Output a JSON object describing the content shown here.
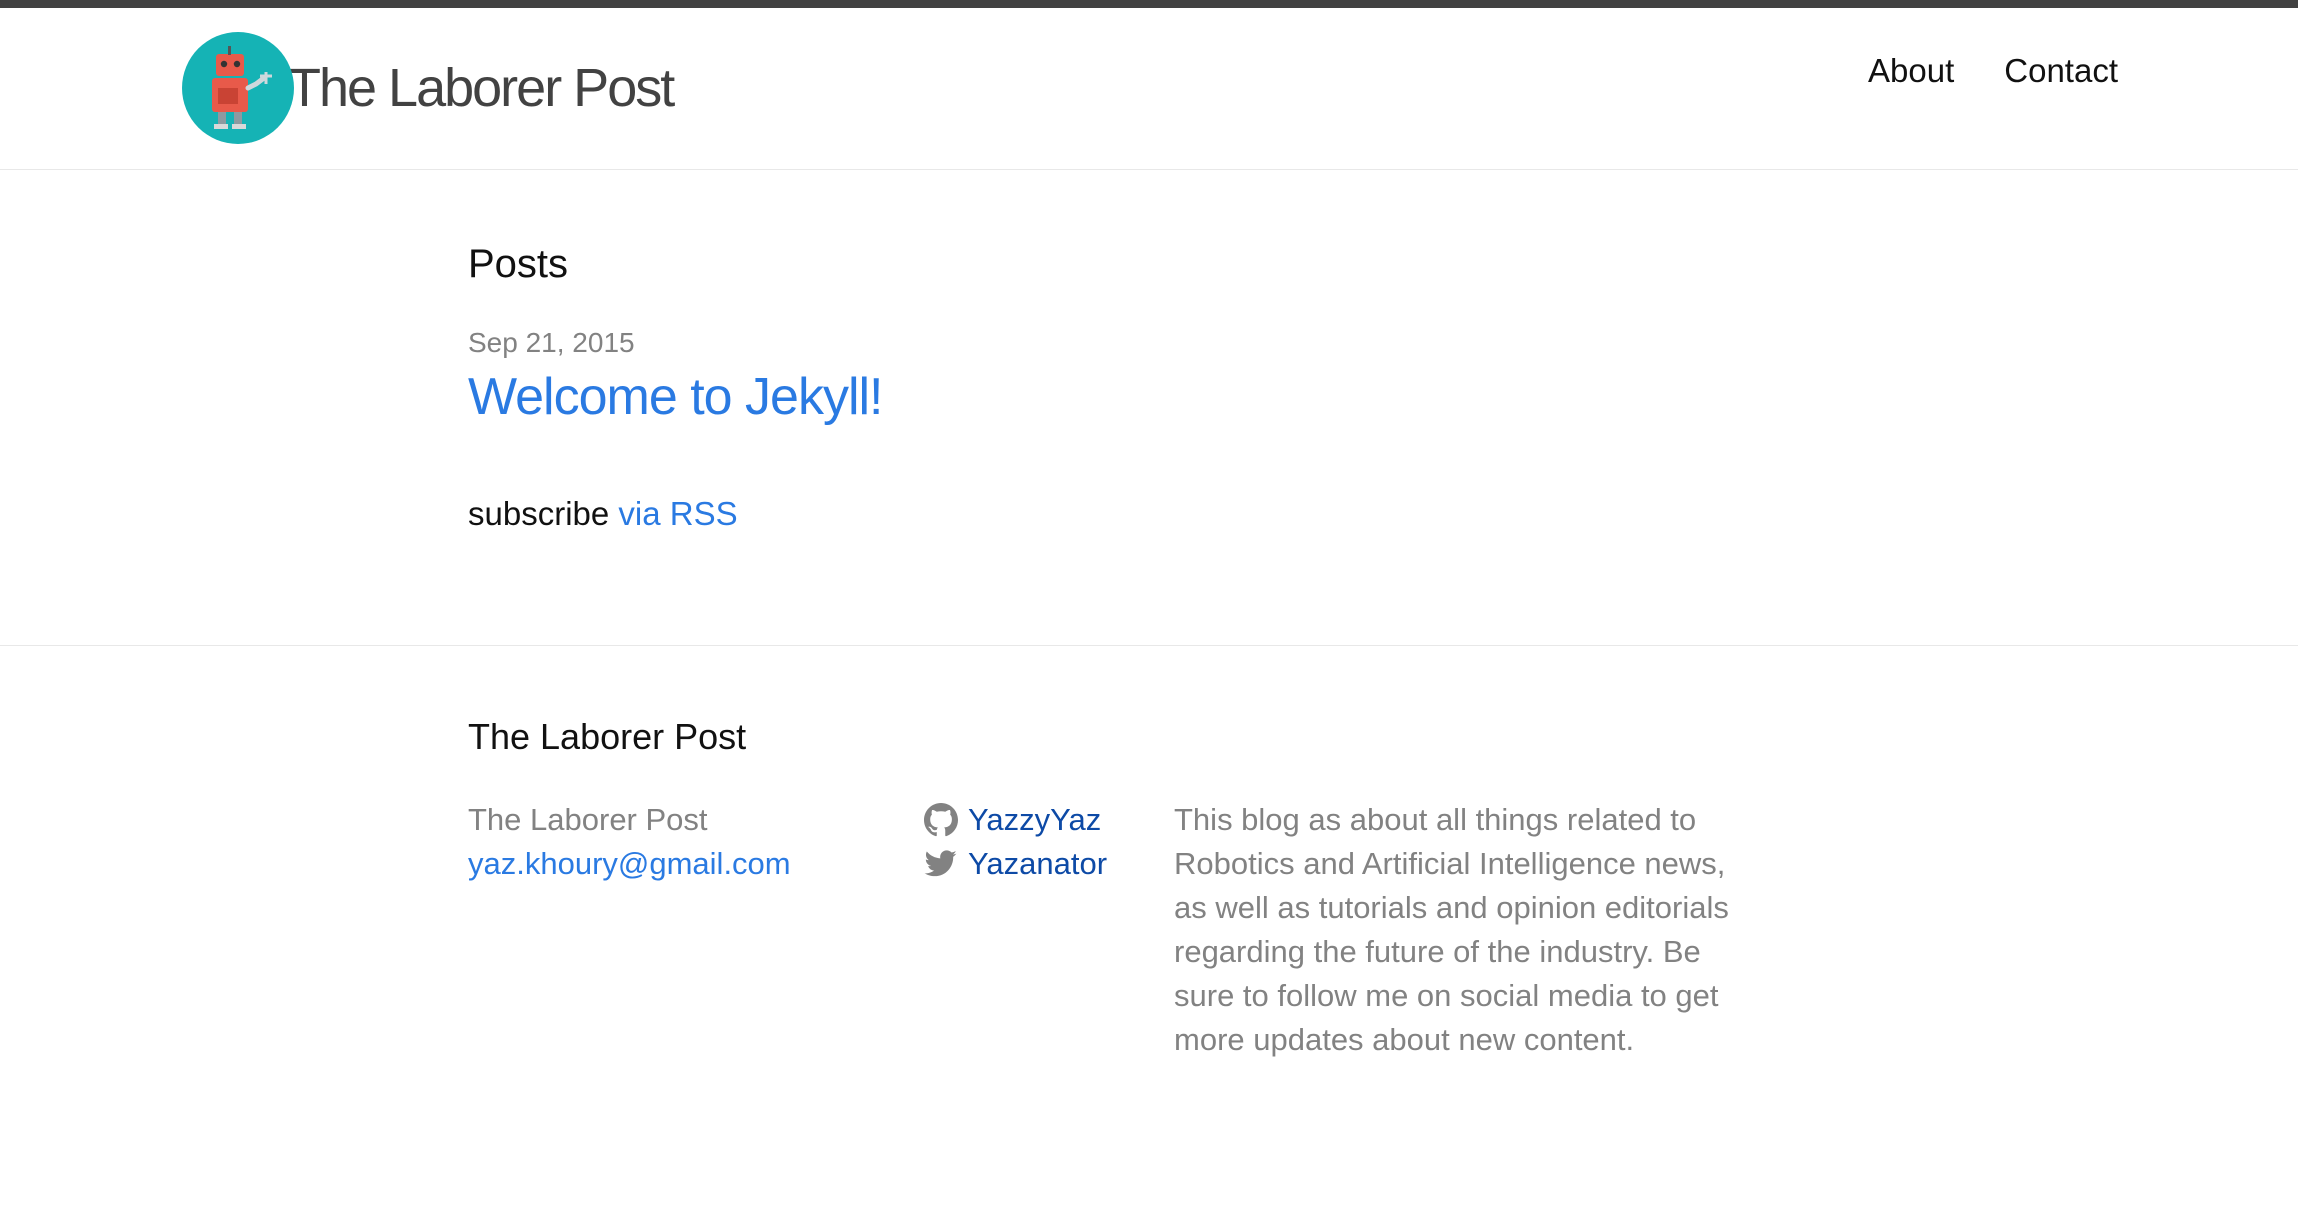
{
  "site": {
    "title": "The Laborer Post",
    "logo_icon": "robot-logo-icon",
    "colors": {
      "accent": "#2a7ae2",
      "topbar": "#424242",
      "logo_bg": "#15b3b5",
      "muted": "#828282"
    }
  },
  "nav": {
    "items": [
      {
        "label": "About"
      },
      {
        "label": "Contact"
      }
    ]
  },
  "main": {
    "heading": "Posts",
    "posts": [
      {
        "date": "Sep 21, 2015",
        "title": "Welcome to Jekyll!"
      }
    ],
    "rss_prefix": "subscribe",
    "rss_link": "via RSS"
  },
  "footer": {
    "heading": "The Laborer Post",
    "name": "The Laborer Post",
    "email": "yaz.khoury@gmail.com",
    "github": {
      "icon": "github-icon",
      "label": "YazzyYaz"
    },
    "twitter": {
      "icon": "twitter-icon",
      "label": "Yazanator"
    },
    "description": "This blog as about all things related to Robotics and Artificial Intelligence news, as well as tutorials and opinion editorials regarding the future of the industry. Be sure to follow me on social media to get more updates about new content."
  }
}
